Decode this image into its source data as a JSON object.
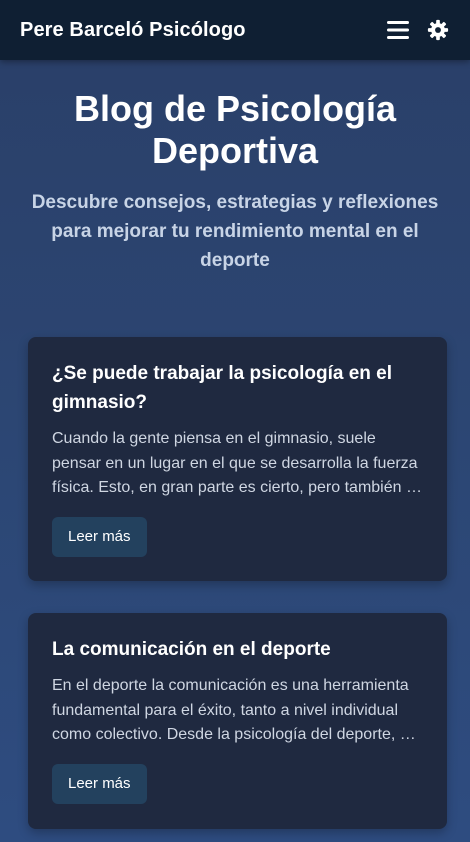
{
  "header": {
    "brand": "Pere Barceló Psicólogo",
    "menu_icon": "hamburger-menu-icon",
    "theme_icon": "gear-icon"
  },
  "hero": {
    "title": "Blog de Psicología Deportiva",
    "subtitle": "Descubre consejos, estrategias y reflexiones para mejorar tu rendimiento mental en el deporte"
  },
  "posts": [
    {
      "title": "¿Se puede trabajar la psicología en el gimnasio?",
      "excerpt": "Cuando la gente piensa en el gimnasio, suele pensar en un lugar en el que se desarrolla la fuerza física. Esto, en gran parte es cierto, pero también …",
      "button": "Leer más"
    },
    {
      "title": "La comunicación en el deporte",
      "excerpt": "En el deporte la comunicación es una herramienta fundamental para el éxito, tanto a nivel individual como colectivo. Desde la psicología del deporte, …",
      "button": "Leer más"
    }
  ],
  "colors": {
    "header_bg": "#0f1f33",
    "page_bg": "#2c4673",
    "card_bg": "#1f2940",
    "button_bg": "#23415e",
    "subtitle": "#c8d4e6"
  }
}
